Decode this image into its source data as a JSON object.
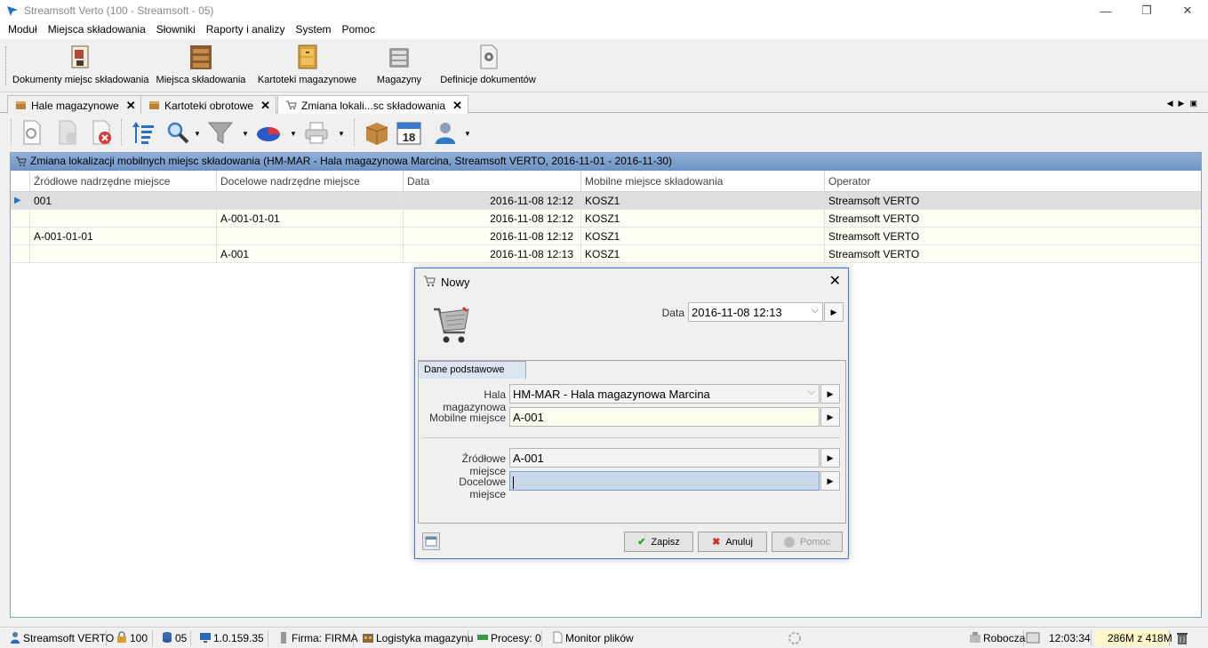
{
  "window": {
    "title": "Streamsoft Verto (100 - Streamsoft - 05)"
  },
  "menu": [
    "Moduł",
    "Miejsca składowania",
    "Słowniki",
    "Raporty i analizy",
    "System",
    "Pomoc"
  ],
  "ribbon": [
    {
      "label": "Dokumenty miejsc składowania",
      "icon": "documents-icon"
    },
    {
      "label": "Miejsca składowania",
      "icon": "shelf-icon"
    },
    {
      "label": "Kartoteki magazynowe",
      "icon": "file-cabinet-icon"
    },
    {
      "label": "Magazyny",
      "icon": "warehouse-server-icon"
    },
    {
      "label": "Definicje dokumentów",
      "icon": "gear-document-icon"
    }
  ],
  "tabs": [
    {
      "label": "Hale magazynowe"
    },
    {
      "label": "Kartoteki obrotowe"
    },
    {
      "label": "Zmiana lokali...sc składowania"
    }
  ],
  "grid": {
    "title": "Zmiana lokalizacji mobilnych miejsc składowania (HM-MAR - Hala magazynowa Marcina, Streamsoft VERTO, 2016-11-01 - 2016-11-30)",
    "columns": [
      "Źródłowe nadrzędne miejsce",
      "Docelowe nadrzędne miejsce",
      "Data",
      "Mobilne miejsce składowania",
      "Operator"
    ],
    "rows": [
      {
        "src": "001",
        "dst": "",
        "date": "2016-11-08 12:12",
        "mobile": "KOSZ1",
        "operator": "Streamsoft VERTO",
        "indicator": "▶"
      },
      {
        "src": "",
        "dst": "A-001-01-01",
        "date": "2016-11-08 12:12",
        "mobile": "KOSZ1",
        "operator": "Streamsoft VERTO",
        "indicator": ""
      },
      {
        "src": "A-001-01-01",
        "dst": "",
        "date": "2016-11-08 12:12",
        "mobile": "KOSZ1",
        "operator": "Streamsoft VERTO",
        "indicator": ""
      },
      {
        "src": "",
        "dst": "A-001",
        "date": "2016-11-08 12:13",
        "mobile": "KOSZ1",
        "operator": "Streamsoft VERTO",
        "indicator": ""
      }
    ]
  },
  "dialog": {
    "title": "Nowy",
    "date_label": "Data",
    "date_value": "2016-11-08 12:13",
    "tab_label": "Dane podstawowe",
    "hall_label": "Hala magazynowa",
    "hall_value": "HM-MAR - Hala magazynowa Marcina",
    "mobile_label": "Mobilne miejsce",
    "mobile_value": "A-001",
    "source_label": "Źródłowe miejsce",
    "source_value": "A-001",
    "target_label": "Docelowe miejsce",
    "target_value": "",
    "save_label": "Zapisz",
    "cancel_label": "Anuluj",
    "help_label": "Pomoc"
  },
  "status": {
    "app": "Streamsoft VERTO",
    "company_no": "100",
    "db_no": "05",
    "version": "1.0.159.35",
    "firm": "Firma: FIRMA",
    "module": "Logistyka magazynu",
    "processes": "Procesy: 0",
    "file_monitor": "Monitor plików",
    "workspace": "Robocza",
    "time": "12:03:34",
    "memory": "286M z 418M"
  },
  "colors": {
    "accent": "#3b79c9",
    "grid_header": "#7fa3cf",
    "row_bg": "#fffff3"
  }
}
